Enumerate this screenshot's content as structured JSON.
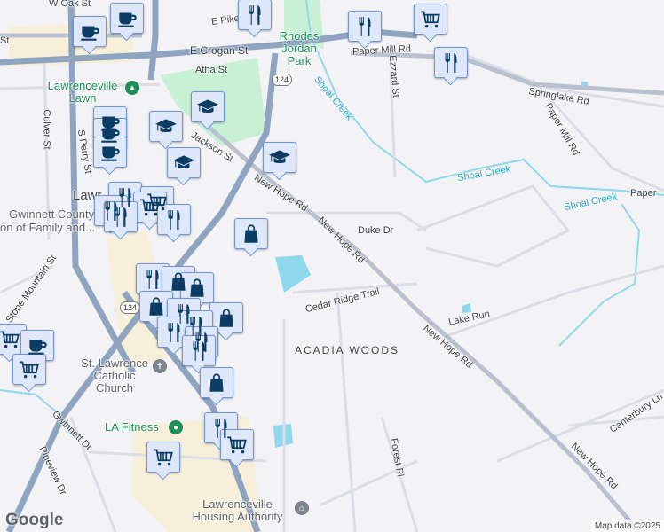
{
  "map": {
    "streets": [
      "W Oak St",
      "E Pike St",
      "E Crogan St",
      "Atha St",
      "Culver St",
      "S Perry St",
      "Jackson St",
      "New Hope Rd",
      "New Hope Rd",
      "Duke Dr",
      "Cedar Ridge Trail",
      "Lake Run",
      "New Hope Rd",
      "New Hope Rd",
      "Paper Mill Rd",
      "Paper Mill Rd",
      "Springlake Rd",
      "Ezzard St",
      "Canterbury Ln",
      "Forest Pl",
      "Gwinnett Dr",
      "Pineview Dr",
      "Stone Mountain St",
      "Paper",
      "St"
    ],
    "parks": [
      "Rhodes Jordan Park",
      "Lawrenceville Lawn"
    ],
    "water": [
      "Shoal Creek",
      "Shoal Creek",
      "Shoal Creek"
    ],
    "places": [
      "St. Lawrence Catholic Church",
      "LA Fitness",
      "Lawrenceville Housing Authority",
      "Gwinnett County",
      "on of Family and...",
      "Lawr"
    ],
    "area": "ACADIA WOODS",
    "route_shield": "124",
    "colors": {
      "pin_fill": "#dfe8fb",
      "pin_border": "#6f95d9",
      "icon": "#0b3d64",
      "road": "#8ea4c0",
      "park": "#c8f0d4",
      "water": "#8fd8ec"
    }
  },
  "google_logo": "Google",
  "attribution": "Map data ©2025"
}
